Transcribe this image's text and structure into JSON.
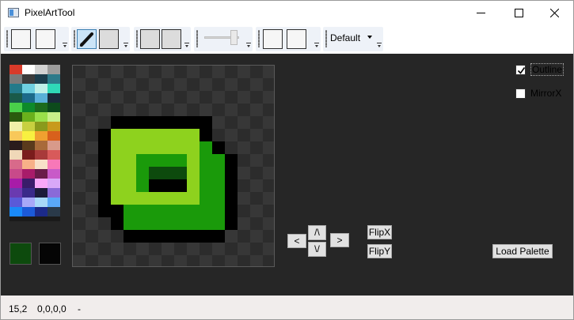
{
  "window": {
    "title": "PixelArtTool",
    "minimize_icon": "minimize-icon",
    "maximize_icon": "maximize-icon",
    "close_icon": "close-icon"
  },
  "toolbar": {
    "pencil_icon": "pencil-icon",
    "combo_value": "Default",
    "overflow_icon": "toolbar-overflow-icon"
  },
  "palette": {
    "colors": [
      "#d83a2a",
      "#ffffff",
      "#d2d2d2",
      "#9c9c9c",
      "#7a7a7a",
      "#3b3b3b",
      "#1c3d4c",
      "#2d7a8a",
      "#237a8a",
      "#6fd0e0",
      "#bff0e8",
      "#2fd8b8",
      "#1a5a4a",
      "#1c6a8a",
      "#59b0d8",
      "#1a2a3a",
      "#4ad04a",
      "#0d8a2a",
      "#1c6a1c",
      "#0d4a1c",
      "#2a5a0d",
      "#6ab01c",
      "#9ae04a",
      "#c8f08a",
      "#f0f0a8",
      "#c8d040",
      "#8a9a1c",
      "#c89a1c",
      "#f8c85a",
      "#f8f040",
      "#f0a030",
      "#d8601c",
      "#2a1c1c",
      "#5a3a1c",
      "#a86a3a",
      "#d89a8a",
      "#f0d8b8",
      "#7a1c1c",
      "#a83a3a",
      "#d85a5a",
      "#d86a8a",
      "#f8b088",
      "#f8e0c8",
      "#f878b8",
      "#c84a8a",
      "#a81c6a",
      "#6a1c4a",
      "#c85ac8",
      "#a81ca8",
      "#3a1c6a",
      "#f8a8f8",
      "#d8a8f8",
      "#6a3ab0",
      "#3a2a8a",
      "#1c1c3a",
      "#8a6ad8",
      "#5a5ad8",
      "#a8a8f8",
      "#a8d8f8",
      "#5aa8f8",
      "#1a8af8",
      "#1c5ad8",
      "#1c2a8a",
      "#2a3a4a"
    ],
    "primary_color": "#0d4a0d",
    "secondary_color": "#050505"
  },
  "pixel_colors": {
    "black": "#000000",
    "light_green": "#8ed21e",
    "mid_green": "#1a9a0a",
    "dark_green": "#0d4a0d",
    "canvas_bg_dark": "#2c2c2c",
    "canvas_bg_light": "#373737"
  },
  "pixels": [
    {
      "x": 3,
      "y": 4,
      "w": 8,
      "h": 1,
      "c": "black"
    },
    {
      "x": 2,
      "y": 5,
      "w": 1,
      "h": 7,
      "c": "black"
    },
    {
      "x": 3,
      "y": 11,
      "w": 1,
      "h": 1,
      "c": "black"
    },
    {
      "x": 3,
      "y": 5,
      "w": 7,
      "h": 1,
      "c": "light_green"
    },
    {
      "x": 10,
      "y": 5,
      "w": 1,
      "h": 1,
      "c": "black"
    },
    {
      "x": 3,
      "y": 6,
      "w": 1,
      "h": 5,
      "c": "light_green"
    },
    {
      "x": 4,
      "y": 10,
      "w": 6,
      "h": 1,
      "c": "light_green"
    },
    {
      "x": 9,
      "y": 6,
      "w": 1,
      "h": 4,
      "c": "light_green"
    },
    {
      "x": 4,
      "y": 6,
      "w": 5,
      "h": 1,
      "c": "light_green"
    },
    {
      "x": 4,
      "y": 7,
      "w": 1,
      "h": 3,
      "c": "light_green"
    },
    {
      "x": 5,
      "y": 7,
      "w": 4,
      "h": 1,
      "c": "mid_green"
    },
    {
      "x": 5,
      "y": 8,
      "w": 1,
      "h": 2,
      "c": "mid_green"
    },
    {
      "x": 6,
      "y": 8,
      "w": 3,
      "h": 1,
      "c": "dark_green"
    },
    {
      "x": 6,
      "y": 9,
      "w": 3,
      "h": 1,
      "c": "black"
    },
    {
      "x": 10,
      "y": 6,
      "w": 1,
      "h": 1,
      "c": "mid_green"
    },
    {
      "x": 10,
      "y": 7,
      "w": 1,
      "h": 4,
      "c": "mid_green"
    },
    {
      "x": 11,
      "y": 7,
      "w": 1,
      "h": 5,
      "c": "mid_green"
    },
    {
      "x": 4,
      "y": 11,
      "w": 7,
      "h": 1,
      "c": "mid_green"
    },
    {
      "x": 11,
      "y": 6,
      "w": 1,
      "h": 1,
      "c": "black"
    },
    {
      "x": 12,
      "y": 7,
      "w": 1,
      "h": 5,
      "c": "black"
    },
    {
      "x": 4,
      "y": 12,
      "w": 8,
      "h": 1,
      "c": "mid_green"
    },
    {
      "x": 12,
      "y": 12,
      "w": 1,
      "h": 1,
      "c": "black"
    },
    {
      "x": 3,
      "y": 12,
      "w": 1,
      "h": 1,
      "c": "black"
    },
    {
      "x": 4,
      "y": 13,
      "w": 8,
      "h": 1,
      "c": "black"
    }
  ],
  "nav": {
    "up": "/\\",
    "down": "\\/",
    "left": "<",
    "right": ">"
  },
  "buttons": {
    "flip_x": "FlipX",
    "flip_y": "FlipY",
    "load_palette": "Load Palette"
  },
  "options": {
    "outline_label": "Outline",
    "outline_checked": true,
    "mirror_label": "MirrorX",
    "mirror_checked": false
  },
  "status": {
    "coords": "15,2",
    "color": "0,0,0,0",
    "extra": "-"
  }
}
